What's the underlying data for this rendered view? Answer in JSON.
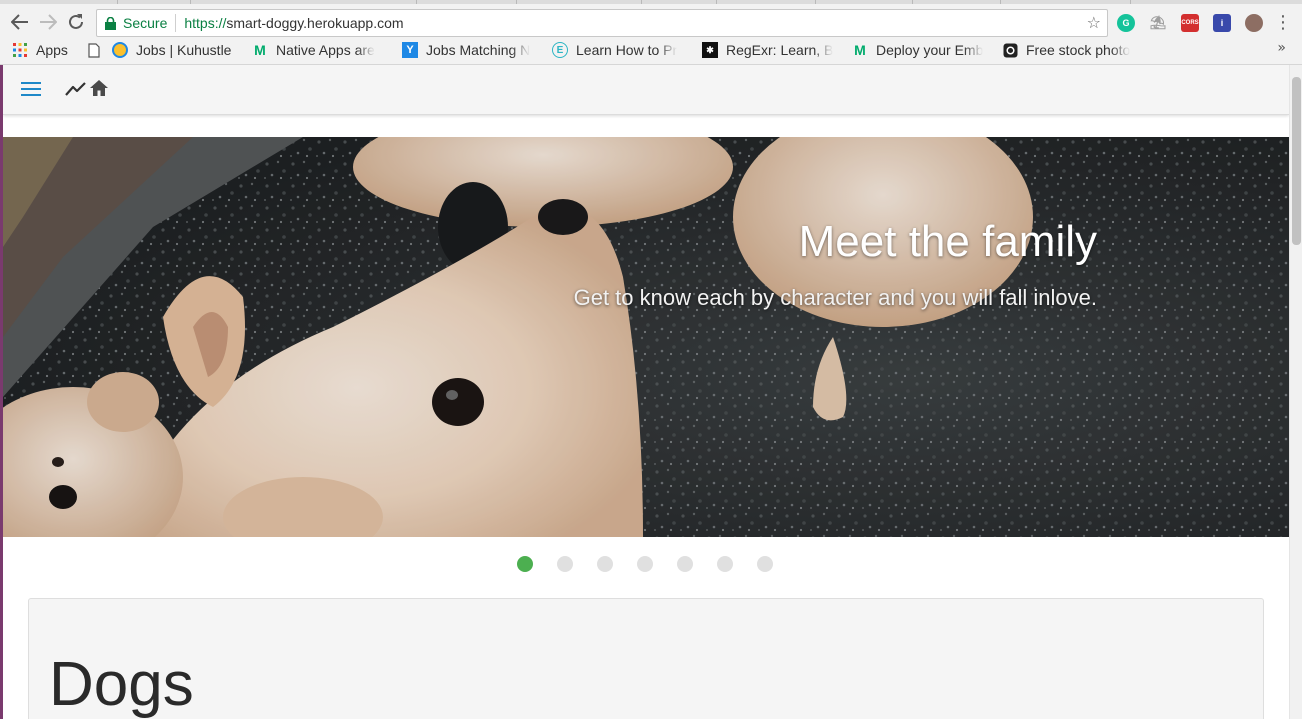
{
  "browser": {
    "secure_label": "Secure",
    "url_scheme": "https://",
    "url_host": "smart-doggy.herokuapp.com",
    "bookmarks": [
      {
        "label": "Apps",
        "icon": "apps-grid-icon"
      },
      {
        "label": "",
        "icon": "blank-page-icon"
      },
      {
        "label": "Jobs | Kuhustle",
        "icon": "kuhustle-icon"
      },
      {
        "label": "Native Apps are",
        "icon": "medium-icon"
      },
      {
        "label": "Jobs Matching N",
        "icon": "job-board-icon"
      },
      {
        "label": "Learn How to Pr",
        "icon": "edx-icon"
      },
      {
        "label": "RegExr: Learn, B",
        "icon": "regexr-icon"
      },
      {
        "label": "Deploy your Emb",
        "icon": "medium-icon"
      },
      {
        "label": "Free stock photo",
        "icon": "camera-icon"
      }
    ],
    "more_bookmarks": "»",
    "extensions": [
      {
        "name": "grammarly-icon",
        "color": "#15c39a"
      },
      {
        "name": "cleaner-icon",
        "color": "#9e9e9e"
      },
      {
        "name": "cors-icon",
        "color": "#d32f2f",
        "text": "CORS"
      },
      {
        "name": "info-extension-icon",
        "color": "#3949ab"
      },
      {
        "name": "profile-avatar-icon",
        "color": "#8d6e63"
      }
    ]
  },
  "app": {
    "nav_icons": [
      "menu-icon",
      "trending-icon",
      "home-icon"
    ],
    "accent_color": "#1e88c8"
  },
  "carousel": {
    "title": "Meet the family",
    "subtitle": "Get to know each by character and you will fall inlove.",
    "slide_count": 7,
    "active_index": 0,
    "active_color": "#4caf50"
  },
  "section": {
    "title": "Dogs"
  }
}
